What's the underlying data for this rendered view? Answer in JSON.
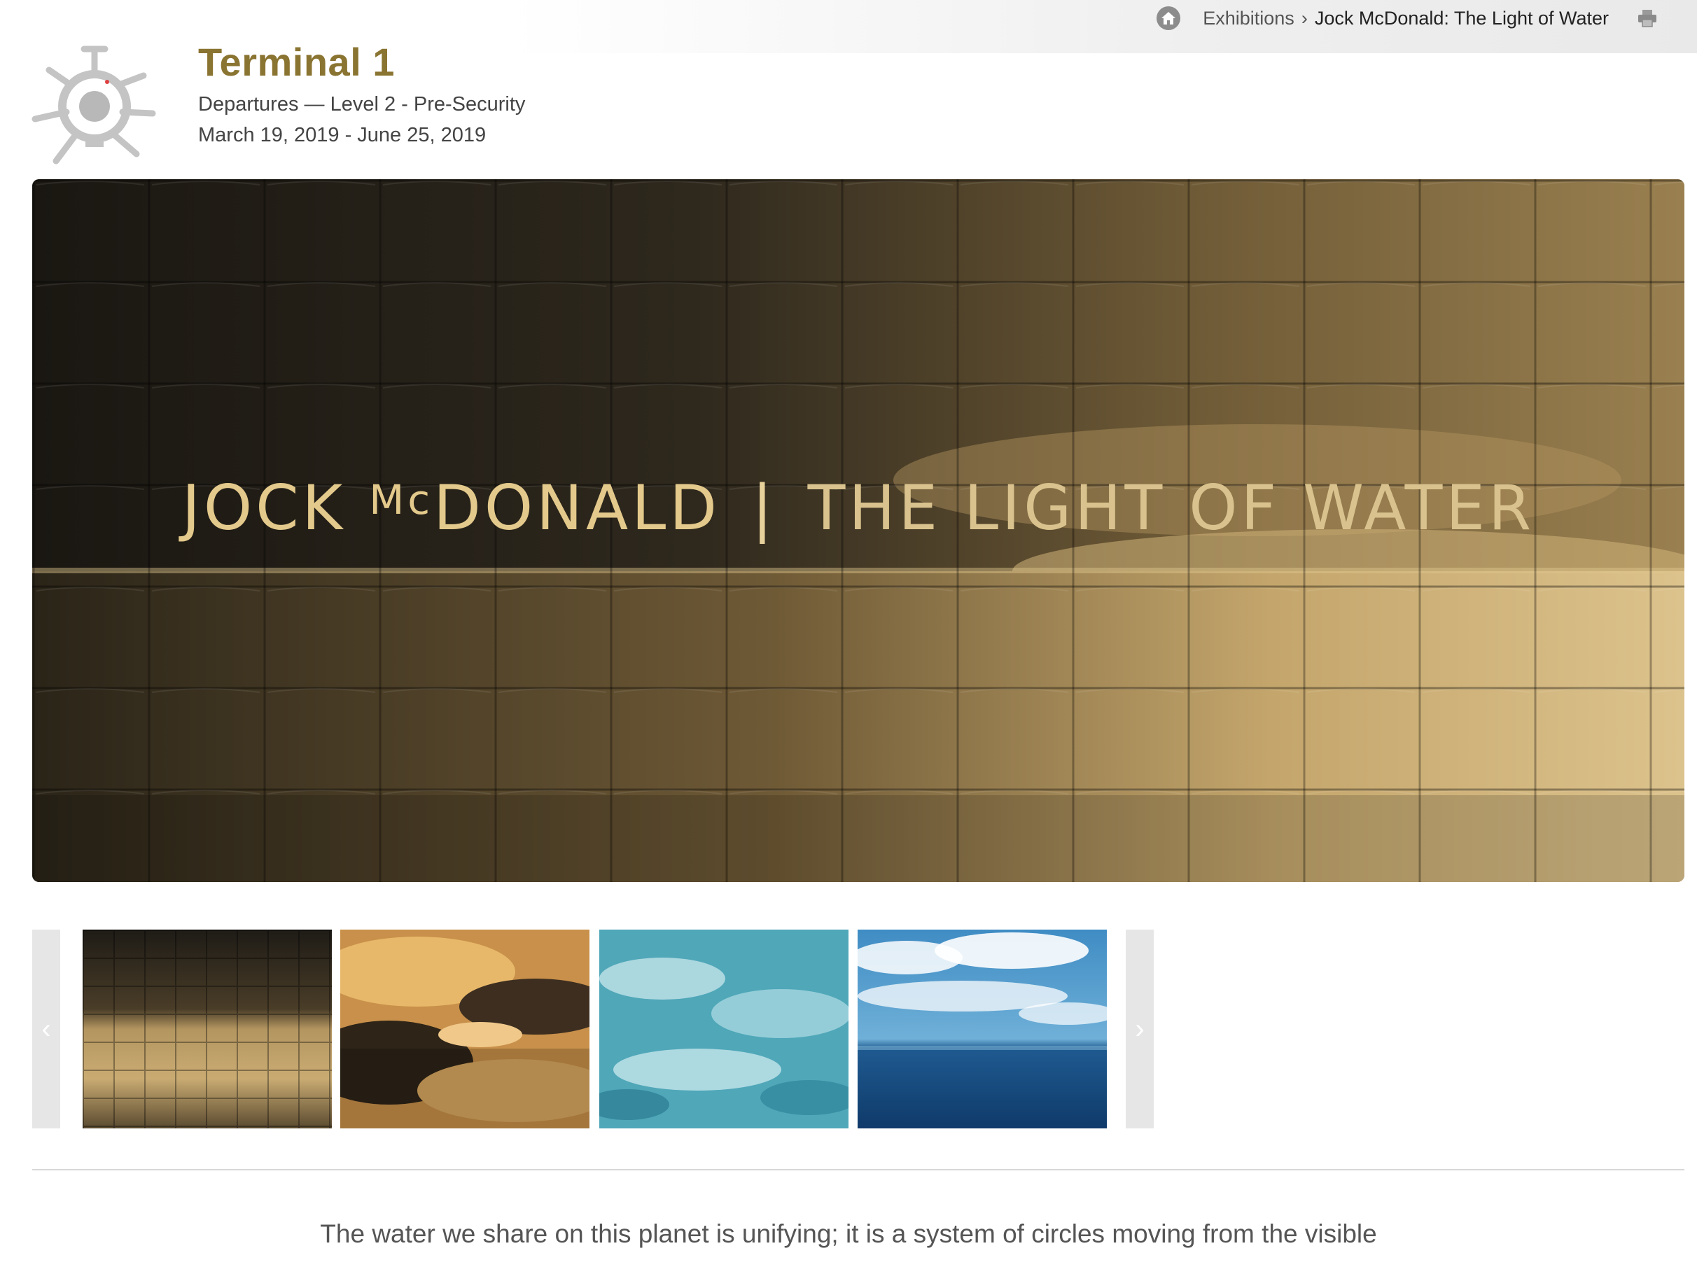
{
  "breadcrumb": {
    "home_icon": "home-icon",
    "items": [
      "Exhibitions",
      "Jock McDonald: The Light of Water"
    ],
    "separator": "›",
    "print_icon": "print-icon"
  },
  "header": {
    "logo": "sfo-museum-logo",
    "title": "Terminal 1",
    "location": "Departures — Level 2 - Pre-Security",
    "dates": "March 19, 2019 - June 25, 2019"
  },
  "hero": {
    "artist": "JOCK",
    "artist_mc": "Mc",
    "artist_rest": "DONALD",
    "divider": "|",
    "exhibition": "THE LIGHT OF WATER"
  },
  "carousel": {
    "prev_label": "‹",
    "next_label": "›",
    "thumbnails": [
      "golden-sea-woven",
      "amber-reflections-woven",
      "turquoise-water-woven",
      "blue-sky-ocean-woven"
    ]
  },
  "intro_text": "The water we share on this planet is unifying; it is a system of circles moving from the visible",
  "colors": {
    "title_gold": "#8a7431",
    "hero_text": "#e3c98b"
  }
}
